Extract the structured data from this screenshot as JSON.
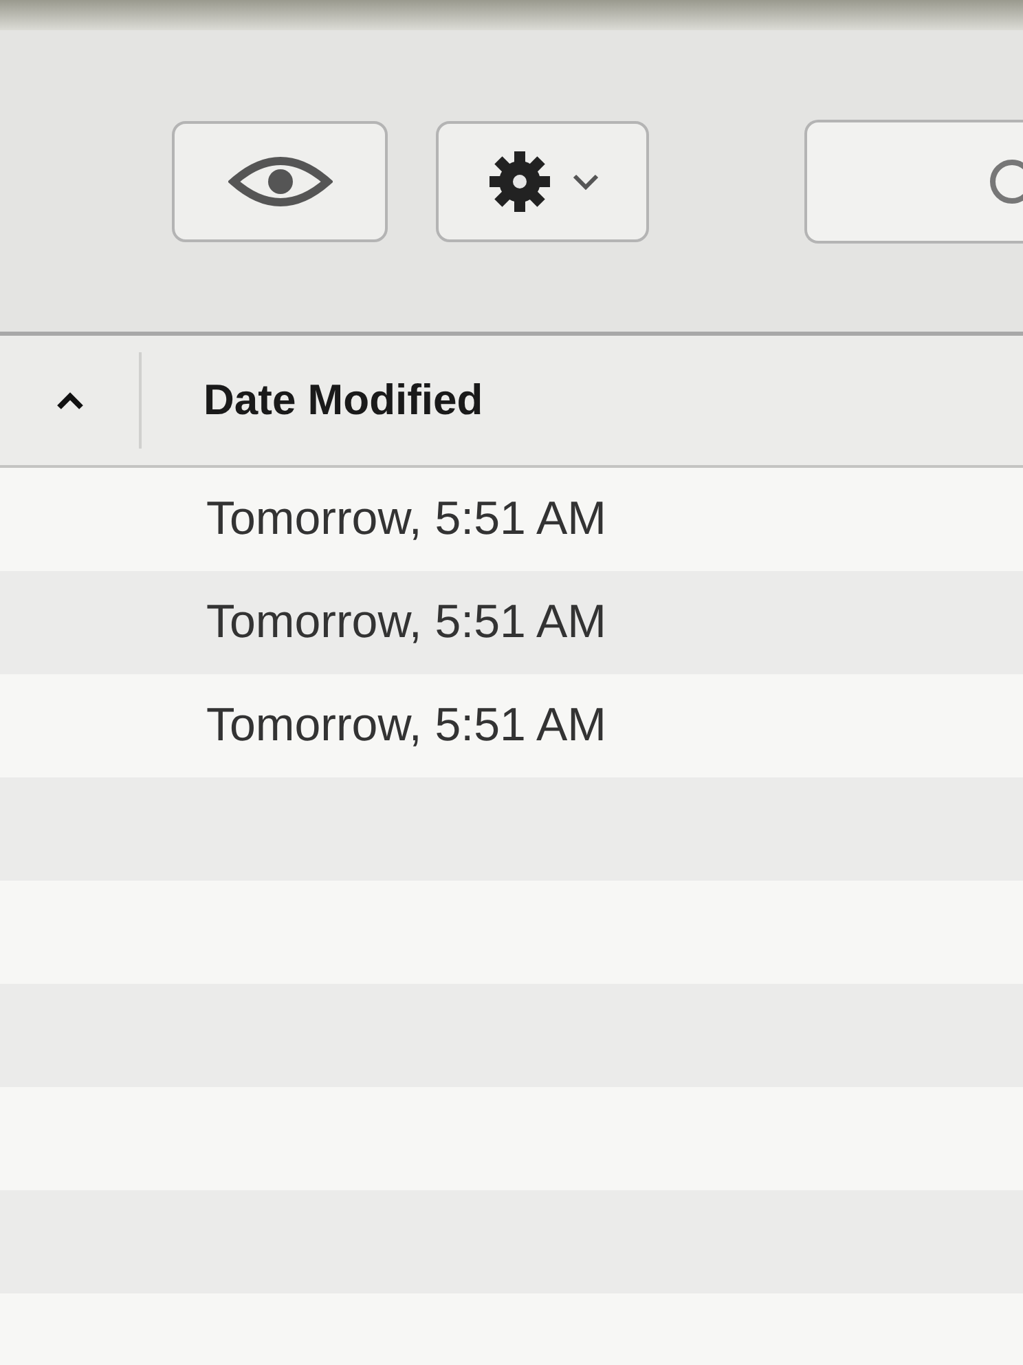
{
  "toolbar": {
    "buttons": [
      {
        "kind": "eye"
      },
      {
        "kind": "gear-menu"
      }
    ],
    "search": {
      "kind": "search"
    }
  },
  "table": {
    "sort_ascending": true,
    "columns": [
      {
        "label": "Date Modified"
      }
    ],
    "rows": [
      {
        "date_modified": "Tomorrow, 5:51 AM"
      },
      {
        "date_modified": "Tomorrow, 5:51 AM"
      },
      {
        "date_modified": "Tomorrow, 5:51 AM"
      }
    ]
  }
}
